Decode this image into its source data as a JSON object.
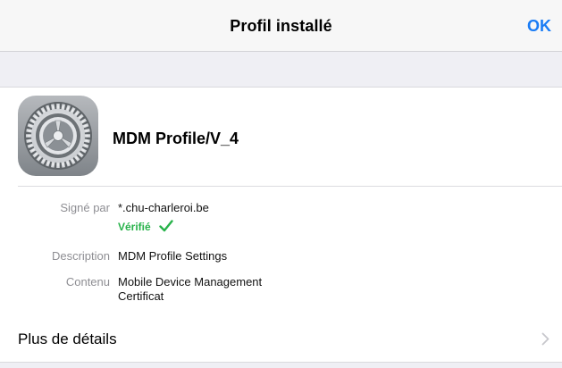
{
  "navbar": {
    "title": "Profil installé",
    "done_label": "OK"
  },
  "profile": {
    "name": "MDM Profile/V_4",
    "icon": "settings-gear-icon"
  },
  "details": {
    "signed_by_label": "Signé par",
    "signed_by_value": "*.chu-charleroi.be",
    "verified_label": "Vérifié",
    "verified_icon": "checkmark-icon",
    "description_label": "Description",
    "description_value": "MDM Profile Settings",
    "contents_label": "Contenu",
    "contents_values": [
      "Mobile Device Management",
      "Certificat"
    ]
  },
  "more": {
    "label": "Plus de détails",
    "icon": "chevron-right-icon"
  },
  "colors": {
    "accent": "#1a7cf5",
    "verified": "#27b24a",
    "secondary_text": "#8e8e93",
    "group_background": "#efeff4"
  }
}
